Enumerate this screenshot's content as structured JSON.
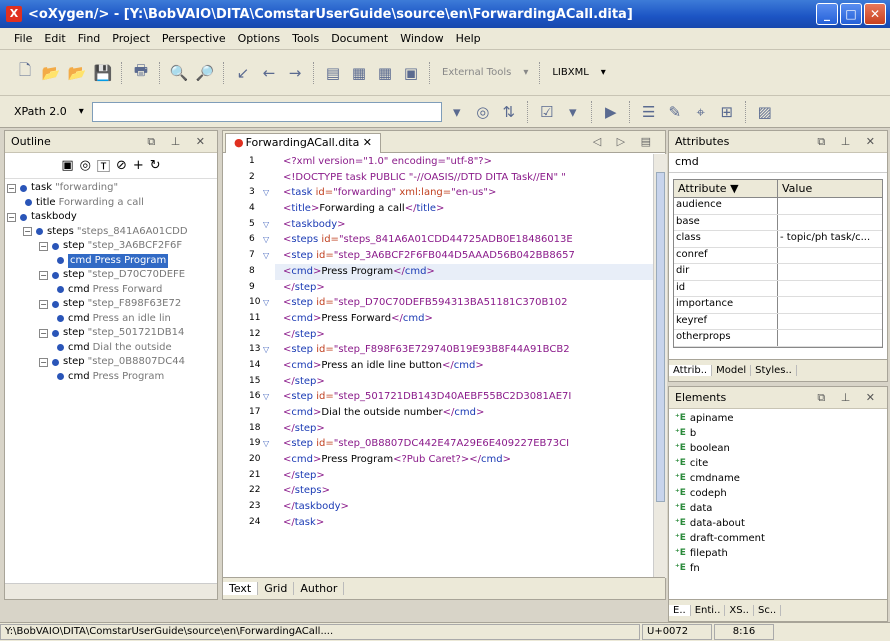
{
  "window": {
    "title": "<oXygen/> - [Y:\\BobVAIO\\DITA\\ComstarUserGuide\\source\\en\\ForwardingACall.dita]",
    "app_icon": "X"
  },
  "menu": [
    "File",
    "Edit",
    "Find",
    "Project",
    "Perspective",
    "Options",
    "Tools",
    "Document",
    "Window",
    "Help"
  ],
  "toolbar": {
    "external_tools": "External Tools",
    "libxml": "LIBXML"
  },
  "xpath": {
    "version": "XPath 2.0",
    "value": ""
  },
  "outline": {
    "title": "Outline",
    "nodes": [
      {
        "name": "task",
        "value": "\"forwarding\"",
        "level": 0,
        "selected": false
      },
      {
        "name": "title",
        "value": "Forwarding a call",
        "level": 1,
        "selected": false
      },
      {
        "name": "taskbody",
        "value": "",
        "level": 0,
        "selected": false
      },
      {
        "name": "steps",
        "value": "\"steps_841A6A01CDD",
        "level": 1,
        "selected": false
      },
      {
        "name": "step",
        "value": "\"step_3A6BCF2F6F",
        "level": 2,
        "selected": false
      },
      {
        "name": "cmd",
        "value": "Press Program",
        "level": 3,
        "selected": true
      },
      {
        "name": "step",
        "value": "\"step_D70C70DEFE",
        "level": 2,
        "selected": false
      },
      {
        "name": "cmd",
        "value": "Press Forward",
        "level": 3,
        "selected": false
      },
      {
        "name": "step",
        "value": "\"step_F898F63E72",
        "level": 2,
        "selected": false
      },
      {
        "name": "cmd",
        "value": "Press an idle lin",
        "level": 3,
        "selected": false
      },
      {
        "name": "step",
        "value": "\"step_501721DB14",
        "level": 2,
        "selected": false
      },
      {
        "name": "cmd",
        "value": "Dial the outside",
        "level": 3,
        "selected": false
      },
      {
        "name": "step",
        "value": "\"step_0B8807DC44",
        "level": 2,
        "selected": false
      },
      {
        "name": "cmd",
        "value": "Press Program",
        "level": 3,
        "selected": false
      }
    ]
  },
  "editor": {
    "tab_label": "ForwardingACall.dita",
    "bottom_tabs": [
      "Text",
      "Grid",
      "Author"
    ],
    "lines": [
      {
        "n": "1",
        "fold": "",
        "html": "<span class='pi'>&lt;?xml version=\"1.0\" encoding=\"utf-8\"?&gt;</span>"
      },
      {
        "n": "2",
        "fold": "",
        "html": "<span class='pi'>&lt;!DOCTYPE task PUBLIC \"-//OASIS//DTD DITA Task//EN\" \"</span>"
      },
      {
        "n": "3",
        "fold": "▽",
        "html": "<span class='lt'>&lt;</span><span class='tg'>task</span> <span class='at'>id=</span><span class='av'>\"forwarding\"</span> <span class='at'>xml:lang=</span><span class='av'>\"en-us\"</span><span class='lt'>&gt;</span>"
      },
      {
        "n": "4",
        "fold": "",
        "html": "<span class='lt'>&lt;</span><span class='tg'>title</span><span class='lt'>&gt;</span>Forwarding a call<span class='lt'>&lt;/</span><span class='tg'>title</span><span class='lt'>&gt;</span>"
      },
      {
        "n": "5",
        "fold": "▽",
        "html": "<span class='lt'>&lt;</span><span class='tg'>taskbody</span><span class='lt'>&gt;</span>"
      },
      {
        "n": "6",
        "fold": "▽",
        "html": "<span class='lt'>&lt;</span><span class='tg'>steps</span> <span class='at'>id=</span><span class='av'>\"steps_841A6A01CDD44725ADB0E18486013E</span>"
      },
      {
        "n": "7",
        "fold": "▽",
        "html": "<span class='lt'>&lt;</span><span class='tg'>step</span> <span class='at'>id=</span><span class='av'>\"step_3A6BCF2F6FB044D5AAAD56B042BB8657</span>"
      },
      {
        "n": "8",
        "fold": "",
        "html": "<span class='lt'>&lt;</span><span class='tg'>cmd</span><span class='lt'>&gt;</span>Press Program<span class='lt'>&lt;/</span><span class='tg'>cmd</span><span class='lt'>&gt;</span>"
      },
      {
        "n": "9",
        "fold": "",
        "html": "<span class='lt'>&lt;/</span><span class='tg'>step</span><span class='lt'>&gt;</span>"
      },
      {
        "n": "10",
        "fold": "▽",
        "html": "<span class='lt'>&lt;</span><span class='tg'>step</span> <span class='at'>id=</span><span class='av'>\"step_D70C70DEFB594313BA51181C370B102</span>"
      },
      {
        "n": "11",
        "fold": "",
        "html": "<span class='lt'>&lt;</span><span class='tg'>cmd</span><span class='lt'>&gt;</span>Press Forward<span class='lt'>&lt;/</span><span class='tg'>cmd</span><span class='lt'>&gt;</span>"
      },
      {
        "n": "12",
        "fold": "",
        "html": "<span class='lt'>&lt;/</span><span class='tg'>step</span><span class='lt'>&gt;</span>"
      },
      {
        "n": "13",
        "fold": "▽",
        "html": "<span class='lt'>&lt;</span><span class='tg'>step</span> <span class='at'>id=</span><span class='av'>\"step_F898F63E729740B19E93B8F44A91BCB2</span>"
      },
      {
        "n": "14",
        "fold": "",
        "html": "<span class='lt'>&lt;</span><span class='tg'>cmd</span><span class='lt'>&gt;</span>Press an idle line button<span class='lt'>&lt;/</span><span class='tg'>cmd</span><span class='lt'>&gt;</span>"
      },
      {
        "n": "15",
        "fold": "",
        "html": "<span class='lt'>&lt;/</span><span class='tg'>step</span><span class='lt'>&gt;</span>"
      },
      {
        "n": "16",
        "fold": "▽",
        "html": "<span class='lt'>&lt;</span><span class='tg'>step</span> <span class='at'>id=</span><span class='av'>\"step_501721DB143D40AEBF55BC2D3081AE7I</span>"
      },
      {
        "n": "17",
        "fold": "",
        "html": "<span class='lt'>&lt;</span><span class='tg'>cmd</span><span class='lt'>&gt;</span>Dial the outside number<span class='lt'>&lt;/</span><span class='tg'>cmd</span><span class='lt'>&gt;</span>"
      },
      {
        "n": "18",
        "fold": "",
        "html": "<span class='lt'>&lt;/</span><span class='tg'>step</span><span class='lt'>&gt;</span>"
      },
      {
        "n": "19",
        "fold": "▽",
        "html": "<span class='lt'>&lt;</span><span class='tg'>step</span> <span class='at'>id=</span><span class='av'>\"step_0B8807DC442E47A29E6E409227EB73CI</span>"
      },
      {
        "n": "20",
        "fold": "",
        "html": "<span class='lt'>&lt;</span><span class='tg'>cmd</span><span class='lt'>&gt;</span>Press Program<span class='pi'>&lt;?Pub Caret?&gt;</span><span class='lt'>&lt;/</span><span class='tg'>cmd</span><span class='lt'>&gt;</span>"
      },
      {
        "n": "21",
        "fold": "",
        "html": "<span class='lt'>&lt;/</span><span class='tg'>step</span><span class='lt'>&gt;</span>"
      },
      {
        "n": "22",
        "fold": "",
        "html": "<span class='lt'>&lt;/</span><span class='tg'>steps</span><span class='lt'>&gt;</span>"
      },
      {
        "n": "23",
        "fold": "",
        "html": "<span class='lt'>&lt;/</span><span class='tg'>taskbody</span><span class='lt'>&gt;</span>"
      },
      {
        "n": "24",
        "fold": "",
        "html": "<span class='lt'>&lt;/</span><span class='tg'>task</span><span class='lt'>&gt;</span>"
      }
    ]
  },
  "attributes": {
    "title": "Attributes",
    "element": "cmd",
    "col_attribute": "Attribute",
    "col_value": "Value",
    "rows": [
      {
        "name": "audience",
        "value": ""
      },
      {
        "name": "base",
        "value": ""
      },
      {
        "name": "class",
        "value": "- topic/ph task/c..."
      },
      {
        "name": "conref",
        "value": ""
      },
      {
        "name": "dir",
        "value": ""
      },
      {
        "name": "id",
        "value": ""
      },
      {
        "name": "importance",
        "value": ""
      },
      {
        "name": "keyref",
        "value": ""
      },
      {
        "name": "otherprops",
        "value": ""
      }
    ],
    "tabs": [
      "Attrib..",
      "Model",
      "Styles.."
    ]
  },
  "elements": {
    "title": "Elements",
    "items": [
      "apiname",
      "b",
      "boolean",
      "cite",
      "cmdname",
      "codeph",
      "data",
      "data-about",
      "draft-comment",
      "filepath",
      "fn"
    ],
    "tabs": [
      "E..",
      "Enti..",
      "XS..",
      "Sc.."
    ]
  },
  "status": {
    "path": "Y:\\BobVAIO\\DITA\\ComstarUserGuide\\source\\en\\ForwardingACall....",
    "unicode": "U+0072",
    "position": "8:16"
  }
}
